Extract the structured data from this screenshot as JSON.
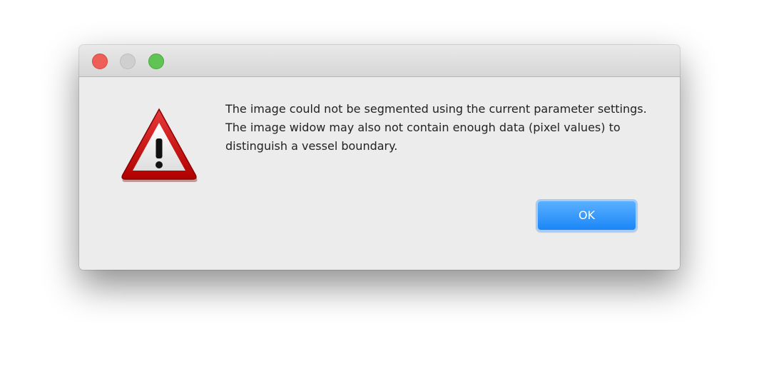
{
  "window": {
    "controls": {
      "close_color": "#ee5f57",
      "minimize_color": "#cfcfcf",
      "maximize_color": "#5fc453"
    }
  },
  "icon": "warning-triangle-icon",
  "message": {
    "line1": "The image could not be segmented using the current parameter settings.",
    "line2": "The image widow may also not contain enough data (pixel values) to distinguish a vessel boundary."
  },
  "buttons": {
    "ok_label": "OK"
  },
  "colors": {
    "accent": "#1b86f8",
    "warning_red": "#cc1010"
  }
}
